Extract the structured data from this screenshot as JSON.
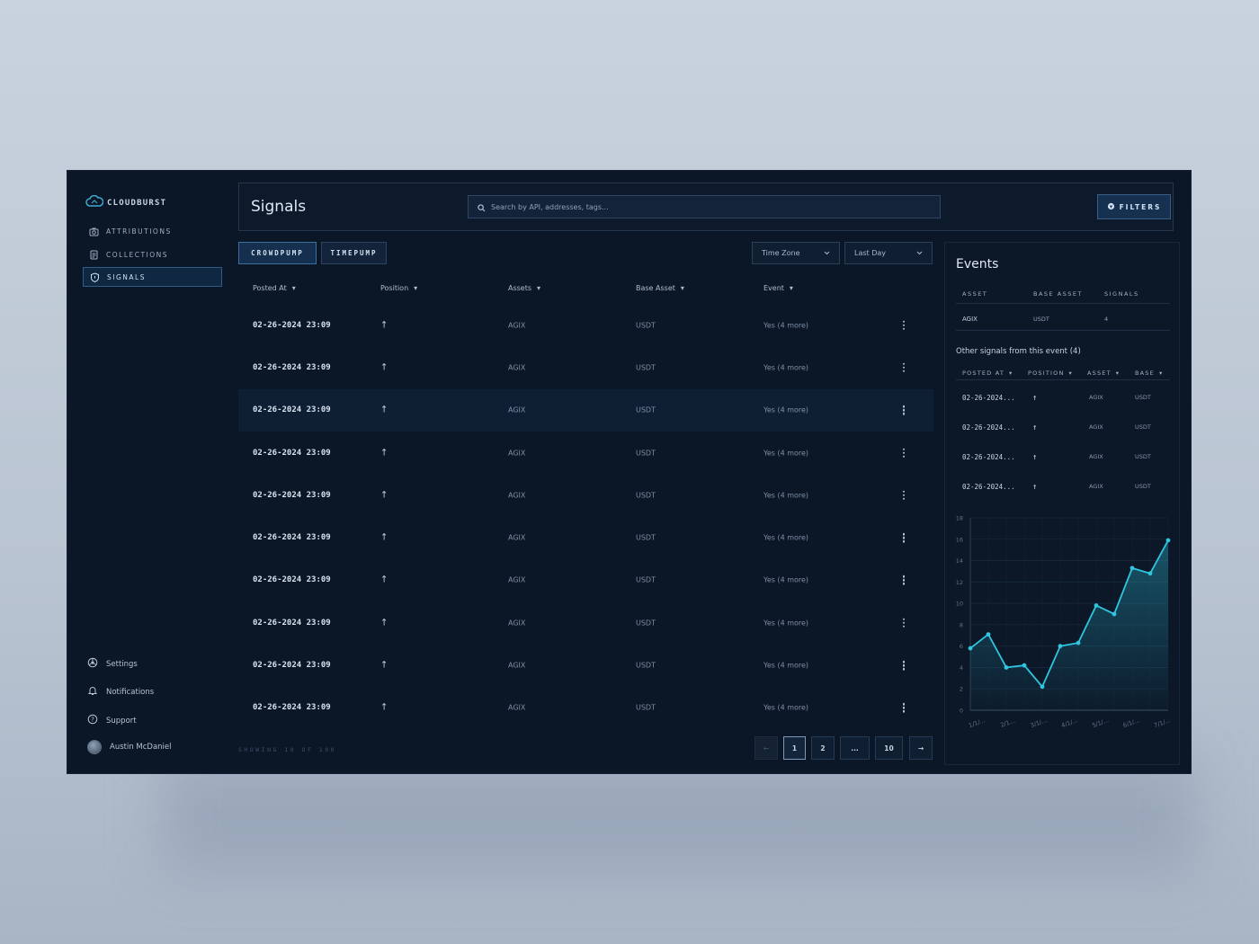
{
  "brand": {
    "name": "CLOUDBURST"
  },
  "sidebar": {
    "items": [
      {
        "label": "ATTRIBUTIONS",
        "icon": "camera-icon"
      },
      {
        "label": "COLLECTIONS",
        "icon": "document-icon"
      },
      {
        "label": "SIGNALS",
        "icon": "shield-icon",
        "active": true
      }
    ],
    "bottom": [
      {
        "label": "Settings",
        "icon": "settings-icon"
      },
      {
        "label": "Notifications",
        "icon": "bell-icon"
      },
      {
        "label": "Support",
        "icon": "help-icon"
      }
    ],
    "user": {
      "name": "Austin McDaniel"
    }
  },
  "header": {
    "title": "Signals",
    "search_placeholder": "Search by API, addresses, tags...",
    "filters_label": "FILTERS"
  },
  "tabs": [
    "CROWDPUMP",
    "TIMEPUMP"
  ],
  "selects": {
    "timezone": "Time Zone",
    "range": "Last Day"
  },
  "table": {
    "columns": [
      "Posted At",
      "Position",
      "Assets",
      "Base Asset",
      "Event"
    ],
    "rows": [
      {
        "posted_at": "02-26-2024 23:09",
        "position": "↑",
        "asset": "AGIX",
        "base": "USDT",
        "event": "Yes (4 more)"
      },
      {
        "posted_at": "02-26-2024 23:09",
        "position": "↑",
        "asset": "AGIX",
        "base": "USDT",
        "event": "Yes (4 more)"
      },
      {
        "posted_at": "02-26-2024 23:09",
        "position": "↑",
        "asset": "AGIX",
        "base": "USDT",
        "event": "Yes (4 more)"
      },
      {
        "posted_at": "02-26-2024 23:09",
        "position": "↑",
        "asset": "AGIX",
        "base": "USDT",
        "event": "Yes (4 more)"
      },
      {
        "posted_at": "02-26-2024 23:09",
        "position": "↑",
        "asset": "AGIX",
        "base": "USDT",
        "event": "Yes (4 more)"
      },
      {
        "posted_at": "02-26-2024 23:09",
        "position": "↑",
        "asset": "AGIX",
        "base": "USDT",
        "event": "Yes (4 more)"
      },
      {
        "posted_at": "02-26-2024 23:09",
        "position": "↑",
        "asset": "AGIX",
        "base": "USDT",
        "event": "Yes (4 more)"
      },
      {
        "posted_at": "02-26-2024 23:09",
        "position": "↑",
        "asset": "AGIX",
        "base": "USDT",
        "event": "Yes (4 more)"
      },
      {
        "posted_at": "02-26-2024 23:09",
        "position": "↑",
        "asset": "AGIX",
        "base": "USDT",
        "event": "Yes (4 more)"
      },
      {
        "posted_at": "02-26-2024 23:09",
        "position": "↑",
        "asset": "AGIX",
        "base": "USDT",
        "event": "Yes (4 more)"
      }
    ],
    "highlighted_row": 2,
    "showing": "SHOWING 10 OF 100"
  },
  "pagination": {
    "prev": "←",
    "pages": [
      "1",
      "2",
      "...",
      "10"
    ],
    "current": "1",
    "next": "→"
  },
  "events": {
    "title": "Events",
    "columns": [
      "ASSET",
      "BASE ASSET",
      "SIGNALS"
    ],
    "row": {
      "asset": "AGIX",
      "base": "USDT",
      "signals": "4"
    },
    "other_title": "Other signals from this event (4)",
    "other_columns": [
      "POSTED AT",
      "POSITION",
      "ASSET",
      "BASE"
    ],
    "other_rows": [
      {
        "posted_at": "02-26-2024...",
        "position": "↑",
        "asset": "AGIX",
        "base": "USDT"
      },
      {
        "posted_at": "02-26-2024...",
        "position": "↑",
        "asset": "AGIX",
        "base": "USDT"
      },
      {
        "posted_at": "02-26-2024...",
        "position": "↑",
        "asset": "AGIX",
        "base": "USDT"
      },
      {
        "posted_at": "02-26-2024...",
        "position": "↑",
        "asset": "AGIX",
        "base": "USDT"
      }
    ]
  },
  "chart_data": {
    "type": "area",
    "x": [
      0,
      1,
      2,
      3,
      4,
      5,
      6,
      7,
      8,
      9,
      10,
      11,
      12,
      13
    ],
    "values": [
      5.8,
      7.1,
      4.0,
      4.2,
      2.2,
      6.0,
      6.3,
      9.8,
      9.0,
      13.3,
      12.8,
      15.9
    ],
    "series": [
      {
        "values": [
          5.8,
          7.1,
          4.0,
          4.2,
          2.2,
          6.0,
          6.3,
          9.8,
          9.0,
          13.3,
          12.8,
          15.9
        ]
      }
    ],
    "x_tick_labels": [
      "1/1/...",
      "2/1...",
      "3/1/...",
      "4/1/...",
      "5/1/...",
      "6/1/...",
      "7/1/..."
    ],
    "y_ticks": [
      0,
      2,
      4,
      6,
      8,
      10,
      12,
      14,
      16,
      18
    ],
    "ylim": [
      0,
      18
    ],
    "grid": true,
    "color": "#2fc6e0"
  },
  "colors": {
    "accent": "#2fc6e0",
    "background": "#0b1626",
    "active_border": "#2a5d8c"
  }
}
